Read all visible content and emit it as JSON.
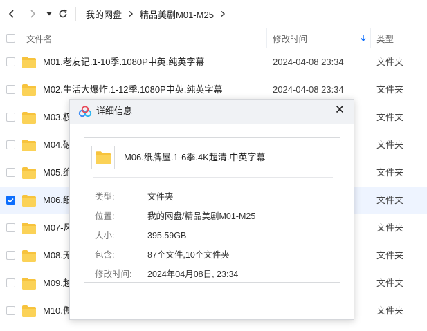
{
  "toolbar": {
    "breadcrumb": [
      "我的网盘",
      "精品美剧M01-M25"
    ]
  },
  "header": {
    "name_label": "文件名",
    "time_label": "修改时间",
    "type_label": "类型",
    "sort": "descending"
  },
  "files": [
    {
      "name": "M01.老友记.1-10季.1080P中英.纯英字幕",
      "time": "2024-04-08 23:34",
      "type": "文件夹",
      "selected": false
    },
    {
      "name": "M02.生活大爆炸.1-12季.1080P中英.纯英字幕",
      "time": "2024-04-08 23:34",
      "type": "文件夹",
      "selected": false
    },
    {
      "name": "M03.权",
      "time": "",
      "type": "文件夹",
      "selected": false
    },
    {
      "name": "M04.破",
      "time": "",
      "type": "文件夹",
      "selected": false
    },
    {
      "name": "M05.绝",
      "time": "",
      "type": "文件夹",
      "selected": false
    },
    {
      "name": "M06.纸",
      "time": "",
      "type": "文件夹",
      "selected": true
    },
    {
      "name": "M07-风",
      "time": "",
      "type": "文件夹",
      "selected": false
    },
    {
      "name": "M08.无",
      "time": "",
      "type": "文件夹",
      "selected": false
    },
    {
      "name": "M09.越",
      "time": "",
      "type": "文件夹",
      "selected": false
    },
    {
      "name": "M10.傲",
      "time": "",
      "type": "文件夹",
      "selected": false
    }
  ],
  "dialog": {
    "title": "详细信息",
    "file_name": "M06.纸牌屋.1-6季.4K超清.中英字幕",
    "info": [
      {
        "label": "类型:",
        "value": "文件夹"
      },
      {
        "label": "位置:",
        "value": "我的网盘/精品美剧M01-M25"
      },
      {
        "label": "大小:",
        "value": "395.59GB"
      },
      {
        "label": "包含:",
        "value": "87个文件,10个文件夹"
      },
      {
        "label": "修改时间:",
        "value": "2024年04月08日, 23:34"
      }
    ]
  },
  "colors": {
    "accent": "#0d6efd",
    "folder": "#f7c33d",
    "selected_row": "#eef4ff"
  }
}
